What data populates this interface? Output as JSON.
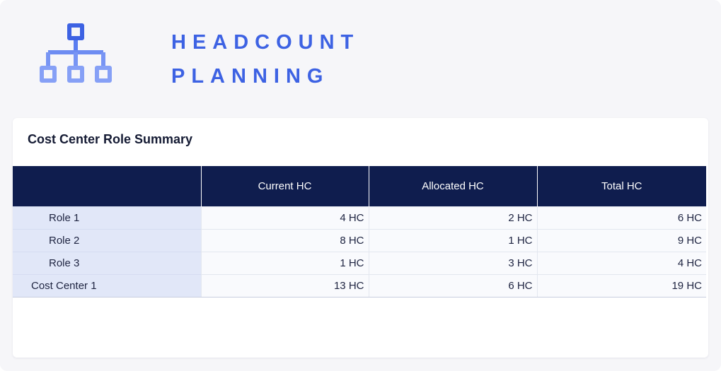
{
  "header": {
    "title_line1": "HEADCOUNT",
    "title_line2": "PLANNING",
    "accent_color": "#3d62e3",
    "icon": "org-chart-icon"
  },
  "card": {
    "title": "Cost Center Role Summary",
    "columns": [
      "",
      "Current HC",
      "Allocated HC",
      "Total HC"
    ],
    "rows": [
      {
        "label": "Role 1",
        "current": "4 HC",
        "allocated": "2 HC",
        "total": "6 HC"
      },
      {
        "label": "Role 2",
        "current": "8 HC",
        "allocated": "1 HC",
        "total": "9 HC"
      },
      {
        "label": "Role 3",
        "current": "1 HC",
        "allocated": "3 HC",
        "total": "4 HC"
      },
      {
        "label": "Cost Center 1",
        "current": "13 HC",
        "allocated": "6 HC",
        "total": "19 HC"
      }
    ],
    "header_color": "#0f1d4e",
    "rowhead_color": "#e1e7f8"
  }
}
